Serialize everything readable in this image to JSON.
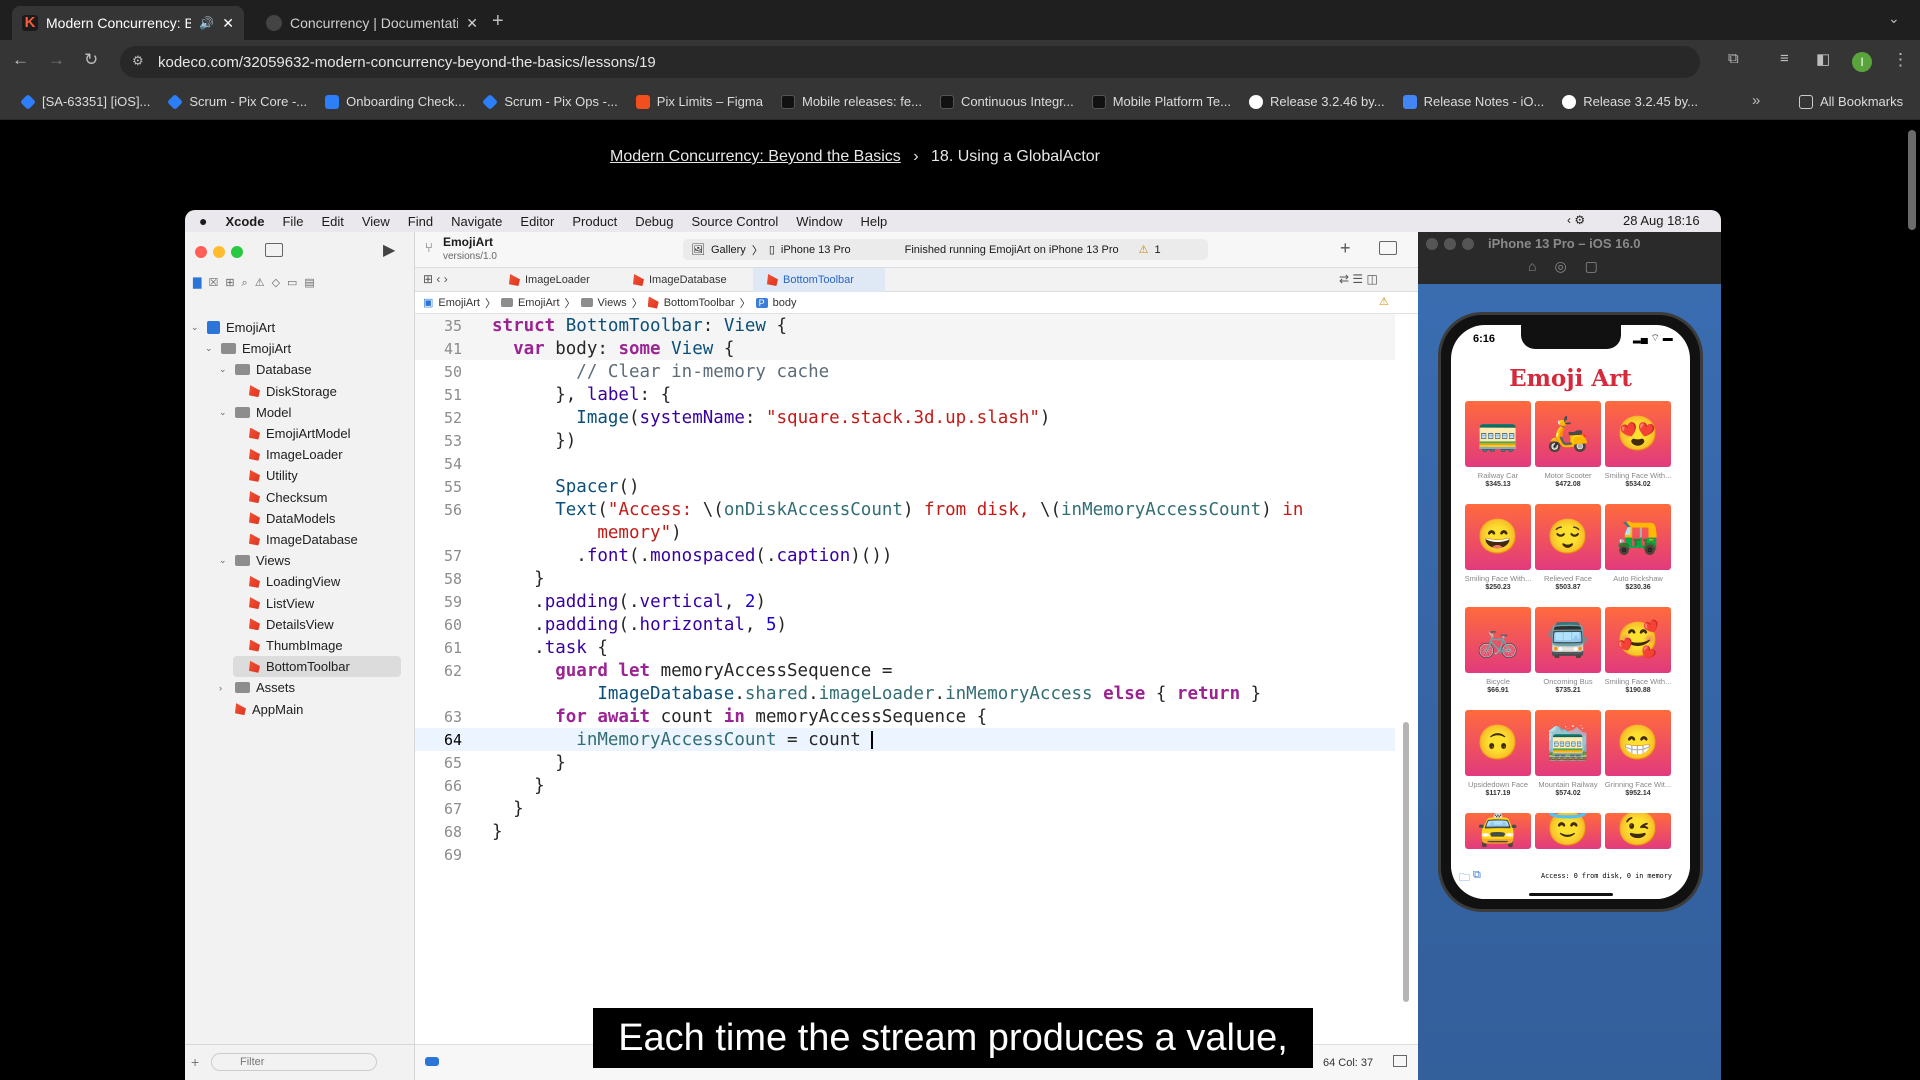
{
  "browser": {
    "tabs": [
      {
        "title": "Modern Concurrency: Bey",
        "active": true,
        "audio_icon": "speaker-icon"
      },
      {
        "title": "Concurrency | Documentation",
        "active": false
      }
    ],
    "url": "kodeco.com/32059632-modern-concurrency-beyond-the-basics/lessons/19",
    "profile_initial": "I",
    "bookmarks": [
      "[SA-63351] [iOS]...",
      "Scrum - Pix Core -...",
      "Onboarding Check...",
      "Scrum - Pix Ops -...",
      "Pix Limits – Figma",
      "Mobile releases: fe...",
      "Continuous Integr...",
      "Mobile Platform Te...",
      "Release 3.2.46 by...",
      "Release Notes - iO...",
      "Release 3.2.45 by..."
    ],
    "all_bookmarks": "All Bookmarks",
    "bookmark_icon_colors": [
      "#2d7ff9",
      "#2d7ff9",
      "#2d7ff9",
      "#2d7ff9",
      "#f24e1e",
      "#222222",
      "#222222",
      "#222222",
      "#ffffff",
      "#4285f4",
      "#ffffff"
    ]
  },
  "lesson": {
    "course_link": "Modern Concurrency: Beyond the Basics",
    "separator": "›",
    "lesson_title": "18. Using a GlobalActor"
  },
  "mac": {
    "menu": [
      "Xcode",
      "File",
      "Edit",
      "View",
      "Find",
      "Navigate",
      "Editor",
      "Product",
      "Debug",
      "Source Control",
      "Window",
      "Help"
    ],
    "clock": "28 Aug  18:16"
  },
  "xcode": {
    "project": "EmojiArt",
    "project_sub": "versions/1.0",
    "scheme": "Gallery",
    "destination": "iPhone 13 Pro",
    "status": "Finished running EmojiArt on iPhone 13 Pro",
    "warnings": "1",
    "tabs": [
      "ImageLoader",
      "ImageDatabase",
      "BottomToolbar"
    ],
    "jump": [
      "EmojiArt",
      "EmojiArt",
      "Views",
      "BottomToolbar",
      "body"
    ],
    "filter_placeholder": "Filter",
    "cursor_pos": "64  Col: 37",
    "tree": [
      {
        "label": "EmojiArt",
        "kind": "project",
        "depth": 0
      },
      {
        "label": "EmojiArt",
        "kind": "folder",
        "depth": 1
      },
      {
        "label": "Database",
        "kind": "folder",
        "depth": 2
      },
      {
        "label": "DiskStorage",
        "kind": "swift",
        "depth": 3
      },
      {
        "label": "Model",
        "kind": "folder",
        "depth": 2
      },
      {
        "label": "EmojiArtModel",
        "kind": "swift",
        "depth": 3
      },
      {
        "label": "ImageLoader",
        "kind": "swift",
        "depth": 3
      },
      {
        "label": "Utility",
        "kind": "swift",
        "depth": 3
      },
      {
        "label": "Checksum",
        "kind": "swift",
        "depth": 3
      },
      {
        "label": "DataModels",
        "kind": "swift",
        "depth": 3
      },
      {
        "label": "ImageDatabase",
        "kind": "swift",
        "depth": 3
      },
      {
        "label": "Views",
        "kind": "folder",
        "depth": 2
      },
      {
        "label": "LoadingView",
        "kind": "swift",
        "depth": 3
      },
      {
        "label": "ListView",
        "kind": "swift",
        "depth": 3
      },
      {
        "label": "DetailsView",
        "kind": "swift",
        "depth": 3
      },
      {
        "label": "ThumbImage",
        "kind": "swift",
        "depth": 3
      },
      {
        "label": "BottomToolbar",
        "kind": "swift",
        "depth": 3,
        "selected": true
      },
      {
        "label": "Assets",
        "kind": "folder",
        "depth": 2
      },
      {
        "label": "AppMain",
        "kind": "swift",
        "depth": 2
      }
    ],
    "code": [
      {
        "n": "35",
        "sticky": true,
        "parts": [
          [
            "k",
            "struct "
          ],
          [
            "ty",
            "BottomToolbar"
          ],
          [
            "p",
            ": "
          ],
          [
            "ty",
            "View"
          ],
          [
            "p",
            " {"
          ]
        ]
      },
      {
        "n": "41",
        "sticky": true,
        "parts": [
          [
            "p",
            "  "
          ],
          [
            "k",
            "var "
          ],
          [
            "p",
            "body: "
          ],
          [
            "k",
            "some "
          ],
          [
            "ty",
            "View"
          ],
          [
            "p",
            " {"
          ]
        ]
      },
      {
        "n": "50",
        "parts": [
          [
            "p",
            "        "
          ],
          [
            "cm",
            "// Clear in-memory cache"
          ]
        ]
      },
      {
        "n": "51",
        "parts": [
          [
            "p",
            "      }, "
          ],
          [
            "pr",
            "label"
          ],
          [
            "p",
            ": {"
          ]
        ]
      },
      {
        "n": "52",
        "parts": [
          [
            "p",
            "        "
          ],
          [
            "ty",
            "Image"
          ],
          [
            "p",
            "("
          ],
          [
            "pr",
            "systemName"
          ],
          [
            "p",
            ": "
          ],
          [
            "s",
            "\"square.stack.3d.up.slash\""
          ],
          [
            "p",
            ")"
          ]
        ]
      },
      {
        "n": "53",
        "parts": [
          [
            "p",
            "      })"
          ]
        ]
      },
      {
        "n": "54",
        "parts": [
          [
            "p",
            ""
          ]
        ]
      },
      {
        "n": "55",
        "parts": [
          [
            "p",
            "      "
          ],
          [
            "ty",
            "Spacer"
          ],
          [
            "p",
            "()"
          ]
        ]
      },
      {
        "n": "56",
        "parts": [
          [
            "p",
            "      "
          ],
          [
            "ty",
            "Text"
          ],
          [
            "p",
            "("
          ],
          [
            "s",
            "\"Access: "
          ],
          [
            "p",
            "\\("
          ],
          [
            "fn",
            "onDiskAccessCount"
          ],
          [
            "p",
            ")"
          ],
          [
            "s",
            " from disk, "
          ],
          [
            "p",
            "\\("
          ],
          [
            "fn",
            "inMemoryAccessCount"
          ],
          [
            "p",
            ")"
          ],
          [
            "s",
            " in"
          ]
        ]
      },
      {
        "n": "",
        "parts": [
          [
            "p",
            "          "
          ],
          [
            "s",
            "memory\""
          ],
          [
            "p",
            ")"
          ]
        ]
      },
      {
        "n": "57",
        "parts": [
          [
            "p",
            "        ."
          ],
          [
            "pr",
            "font"
          ],
          [
            "p",
            "(."
          ],
          [
            "pr",
            "monospaced"
          ],
          [
            "p",
            "(."
          ],
          [
            "pr",
            "caption"
          ],
          [
            "p",
            ")())"
          ]
        ]
      },
      {
        "n": "58",
        "parts": [
          [
            "p",
            "    }"
          ]
        ]
      },
      {
        "n": "59",
        "parts": [
          [
            "p",
            "    ."
          ],
          [
            "pr",
            "padding"
          ],
          [
            "p",
            "(."
          ],
          [
            "pr",
            "vertical"
          ],
          [
            "p",
            ", "
          ],
          [
            "nm",
            "2"
          ],
          [
            "p",
            ")"
          ]
        ]
      },
      {
        "n": "60",
        "parts": [
          [
            "p",
            "    ."
          ],
          [
            "pr",
            "padding"
          ],
          [
            "p",
            "(."
          ],
          [
            "pr",
            "horizontal"
          ],
          [
            "p",
            ", "
          ],
          [
            "nm",
            "5"
          ],
          [
            "p",
            ")"
          ]
        ]
      },
      {
        "n": "61",
        "parts": [
          [
            "p",
            "    ."
          ],
          [
            "pr",
            "task"
          ],
          [
            "p",
            " {"
          ]
        ]
      },
      {
        "n": "62",
        "parts": [
          [
            "p",
            "      "
          ],
          [
            "k",
            "guard let "
          ],
          [
            "p",
            "memoryAccessSequence ="
          ]
        ]
      },
      {
        "n": "",
        "parts": [
          [
            "p",
            "          "
          ],
          [
            "ty",
            "ImageDatabase"
          ],
          [
            "p",
            "."
          ],
          [
            "fn",
            "shared"
          ],
          [
            "p",
            "."
          ],
          [
            "fn",
            "imageLoader"
          ],
          [
            "p",
            "."
          ],
          [
            "fn",
            "inMemoryAccess"
          ],
          [
            "k",
            " else "
          ],
          [
            "p",
            "{ "
          ],
          [
            "k",
            "return"
          ],
          [
            "p",
            " }"
          ]
        ]
      },
      {
        "n": "63",
        "parts": [
          [
            "p",
            "      "
          ],
          [
            "k",
            "for await "
          ],
          [
            "p",
            "count "
          ],
          [
            "k",
            "in "
          ],
          [
            "p",
            "memoryAccessSequence {"
          ]
        ]
      },
      {
        "n": "64",
        "current": true,
        "parts": [
          [
            "p",
            "        "
          ],
          [
            "fn",
            "inMemoryAccessCount"
          ],
          [
            "p",
            " = count "
          ]
        ]
      },
      {
        "n": "65",
        "parts": [
          [
            "p",
            "      }"
          ]
        ]
      },
      {
        "n": "66",
        "parts": [
          [
            "p",
            "    }"
          ]
        ]
      },
      {
        "n": "67",
        "parts": [
          [
            "p",
            "  }"
          ]
        ]
      },
      {
        "n": "68",
        "parts": [
          [
            "p",
            "}"
          ]
        ]
      },
      {
        "n": "69",
        "parts": [
          [
            "p",
            ""
          ]
        ]
      }
    ]
  },
  "simulator": {
    "title": "iPhone 13 Pro – iOS 16.0",
    "time": "6:16",
    "app_title": "Emoji Art",
    "footer_text": "Access: 0 from disk, 0 in memory",
    "items": [
      {
        "emoji": "🚃",
        "name": "Railway Car",
        "price": "$345.13"
      },
      {
        "emoji": "🛵",
        "name": "Motor Scooter",
        "price": "$472.08"
      },
      {
        "emoji": "😍",
        "name": "Smiling Face With...",
        "price": "$534.02"
      },
      {
        "emoji": "😄",
        "name": "Smiling Face With...",
        "price": "$250.23"
      },
      {
        "emoji": "😌",
        "name": "Relieved Face",
        "price": "$503.87"
      },
      {
        "emoji": "🛺",
        "name": "Auto Rickshaw",
        "price": "$230.36"
      },
      {
        "emoji": "🚲",
        "name": "Bicycle",
        "price": "$66.91"
      },
      {
        "emoji": "🚍",
        "name": "Oncoming Bus",
        "price": "$735.21"
      },
      {
        "emoji": "🥰",
        "name": "Smiling Face With...",
        "price": "$190.88"
      },
      {
        "emoji": "🙃",
        "name": "Upsidedown Face",
        "price": "$117.19"
      },
      {
        "emoji": "🚞",
        "name": "Mountain Railway",
        "price": "$574.02"
      },
      {
        "emoji": "😁",
        "name": "Grinning Face Wit...",
        "price": "$952.14"
      },
      {
        "emoji": "🚖",
        "name": "",
        "price": ""
      },
      {
        "emoji": "😇",
        "name": "",
        "price": ""
      },
      {
        "emoji": "😉",
        "name": "",
        "price": ""
      }
    ]
  },
  "caption": "Each time the stream produces a value,"
}
